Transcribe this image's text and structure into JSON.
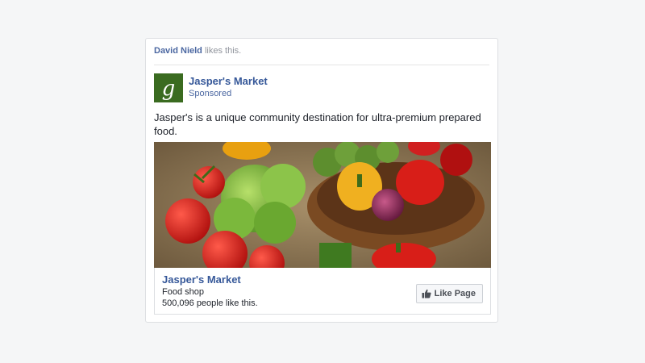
{
  "social_context": {
    "liker": "David Nield",
    "suffix": " likes this."
  },
  "post": {
    "page_name": "Jasper's Market",
    "avatar_letter": "g",
    "sponsored_label": "Sponsored",
    "text": "Jasper's is a unique community destination for ultra-premium prepared food."
  },
  "link_preview": {
    "title": "Jasper's Market",
    "category": "Food shop",
    "likes": "500,096 people like this.",
    "button_label": "Like Page",
    "button_icon": "thumbs-up-icon"
  },
  "colors": {
    "link_blue": "#365899",
    "avatar_green": "#3a6b20",
    "card_border": "#dddfe2"
  }
}
